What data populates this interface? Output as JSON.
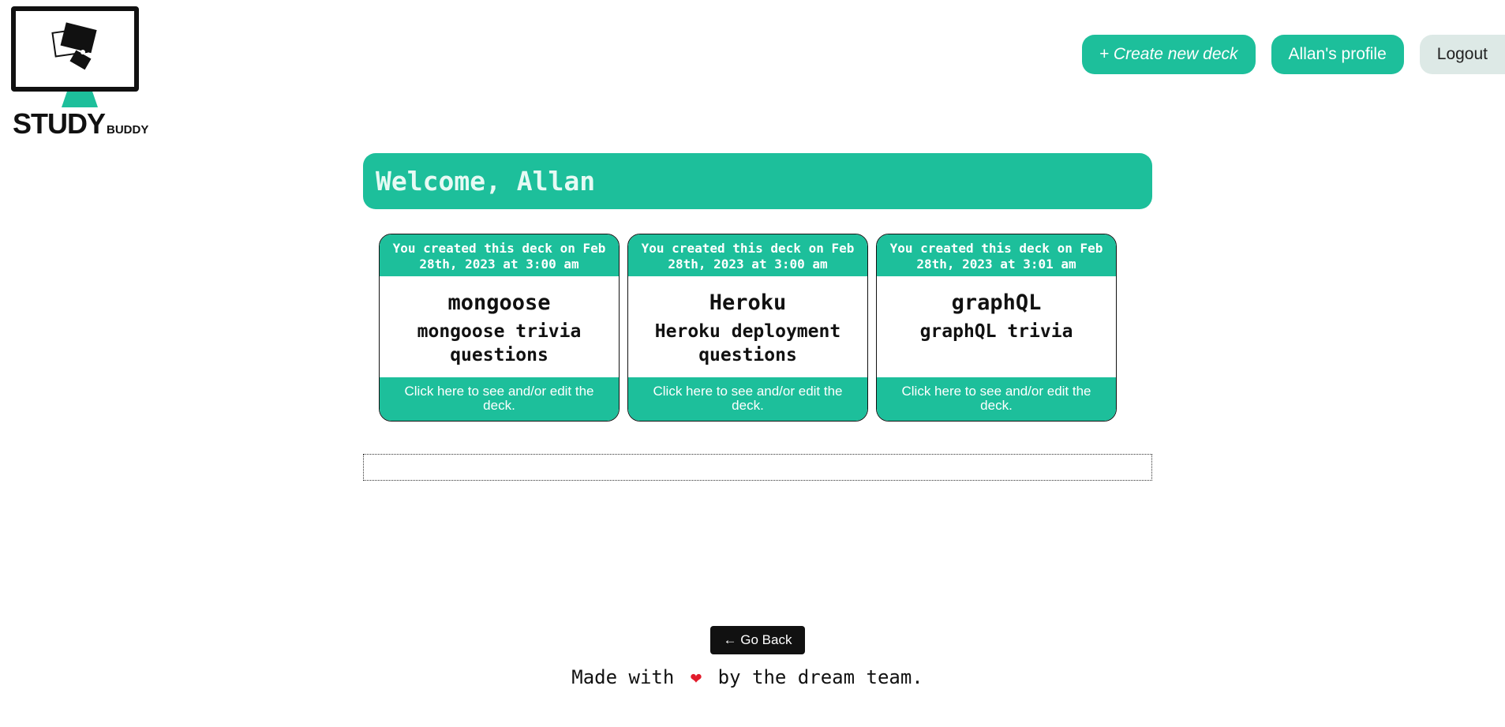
{
  "brand": {
    "name": "STUDY",
    "sub": "BUDDY"
  },
  "nav": {
    "create_label": "+ Create new deck",
    "profile_label": "Allan's profile",
    "logout_label": "Logout"
  },
  "welcome": "Welcome, Allan",
  "decks": [
    {
      "created": "You created this deck on Feb 28th, 2023 at 3:00 am",
      "title": "mongoose",
      "description": "mongoose trivia questions",
      "action": "Click here to see and/or edit the deck."
    },
    {
      "created": "You created this deck on Feb 28th, 2023 at 3:00 am",
      "title": "Heroku",
      "description": "Heroku deployment questions",
      "action": "Click here to see and/or edit the deck."
    },
    {
      "created": "You created this deck on Feb 28th, 2023 at 3:01 am",
      "title": "graphQL",
      "description": "graphQL trivia",
      "action": "Click here to see and/or edit the deck."
    }
  ],
  "back_label": "← Go Back",
  "footer": {
    "before": "Made with",
    "heart": "❤",
    "after": "by the dream team."
  },
  "colors": {
    "accent": "#1dbf9b",
    "logout_bg": "#dde9e6",
    "dark": "#111111"
  },
  "icons": {
    "logo": "flashcards-monitor-logo",
    "heart": "heart-icon"
  }
}
